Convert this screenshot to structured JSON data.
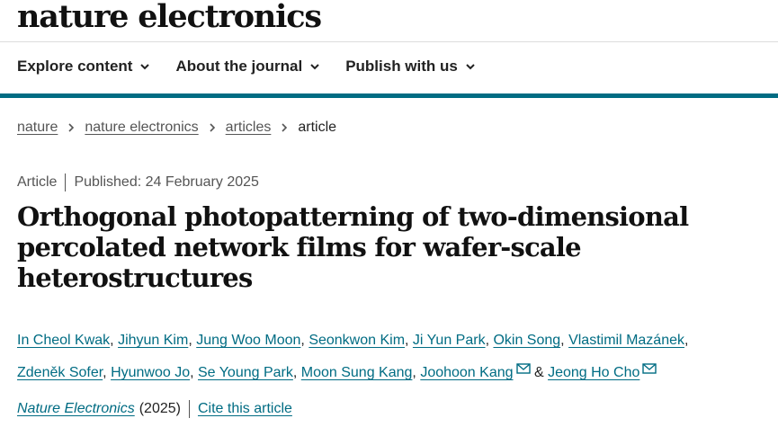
{
  "header": {
    "logo": "nature electronics"
  },
  "nav": [
    {
      "label": "Explore content"
    },
    {
      "label": "About the journal"
    },
    {
      "label": "Publish with us"
    }
  ],
  "breadcrumb": [
    "nature",
    "nature electronics",
    "articles",
    "article"
  ],
  "meta": {
    "type": "Article",
    "published": "Published: 24 February 2025"
  },
  "title": "Orthogonal photopatterning of two-dimensional percolated network films for wafer-scale heterostructures",
  "authors": [
    "In Cheol Kwak",
    "Jihyun Kim",
    "Jung Woo Moon",
    "Seonkwon Kim",
    "Ji Yun Park",
    "Okin Song",
    "Vlastimil Mazánek",
    "Zdeněk Sofer",
    "Hyunwoo Jo",
    "Se Young Park",
    "Moon Sung Kang",
    "Joohoon Kang",
    "Jeong Ho Cho"
  ],
  "authors_sep": ",",
  "authors_and": "&",
  "citation": {
    "journal": "Nature Electronics",
    "year": "(2025)",
    "cite_label": "Cite this article"
  },
  "colors": {
    "accent": "#006c83",
    "text": "#222222",
    "muted": "#555555"
  },
  "icons": {
    "nav_chevron": "chevron-down-icon",
    "crumb_sep": "chevron-right-icon",
    "corresponding": "mail-icon"
  }
}
